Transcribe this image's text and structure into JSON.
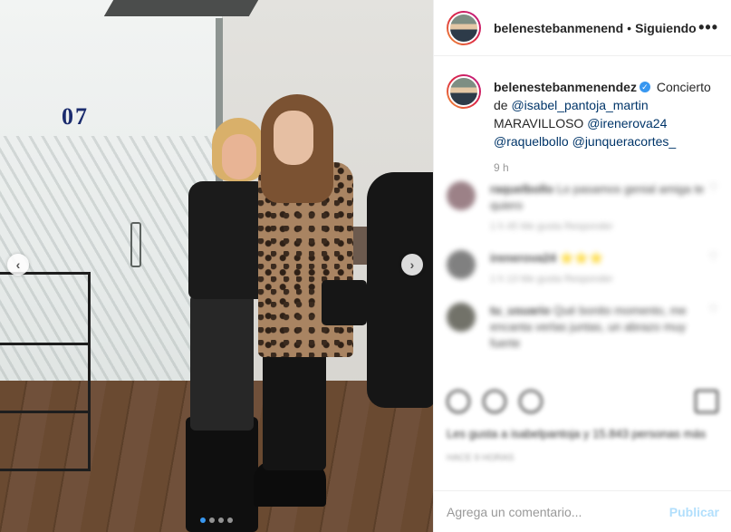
{
  "post": {
    "door_number": "07",
    "carousel": {
      "slide_count": 4,
      "active_index": 0
    },
    "nav": {
      "prev_glyph": "‹",
      "next_glyph": "›"
    }
  },
  "header": {
    "username": "belenestebanmenend",
    "separator": "•",
    "follow_status": "Siguiendo",
    "more_glyph": "•••"
  },
  "caption": {
    "username": "belenestebanmenendez",
    "verified_glyph": "✓",
    "text_1": "Concierto de",
    "mention_1": "@isabel_pantoja_martin",
    "text_2": "MARAVILLOSO",
    "mention_2": "@irenerova24",
    "mention_3": "@raquelbollo",
    "mention_4": "@junqueracortes_",
    "time_ago": "9 h"
  },
  "comments": [
    {
      "username": "raquelbollo",
      "text": "Lo pasamos genial amiga te quiero",
      "meta": "1 h   45 Me gusta   Responder"
    },
    {
      "username": "irenerova24",
      "text": "⭐⭐⭐",
      "meta": "1 h   13 Me gusta   Responder"
    },
    {
      "username": "tu_usuario",
      "text": "Qué bonito momento, me encanta verlas juntas, un abrazo muy fuerte",
      "meta": ""
    }
  ],
  "likes": {
    "text": "Les gusta a isabelpantoja y 15.843 personas más",
    "when": "HACE 9 HORAS"
  },
  "comment_box": {
    "placeholder": "Agrega un comentario...",
    "post_label": "Publicar"
  },
  "colors": {
    "accent": "#3897f0",
    "mention": "#003569",
    "post_disabled": "#b2dffc",
    "muted": "#999999"
  }
}
